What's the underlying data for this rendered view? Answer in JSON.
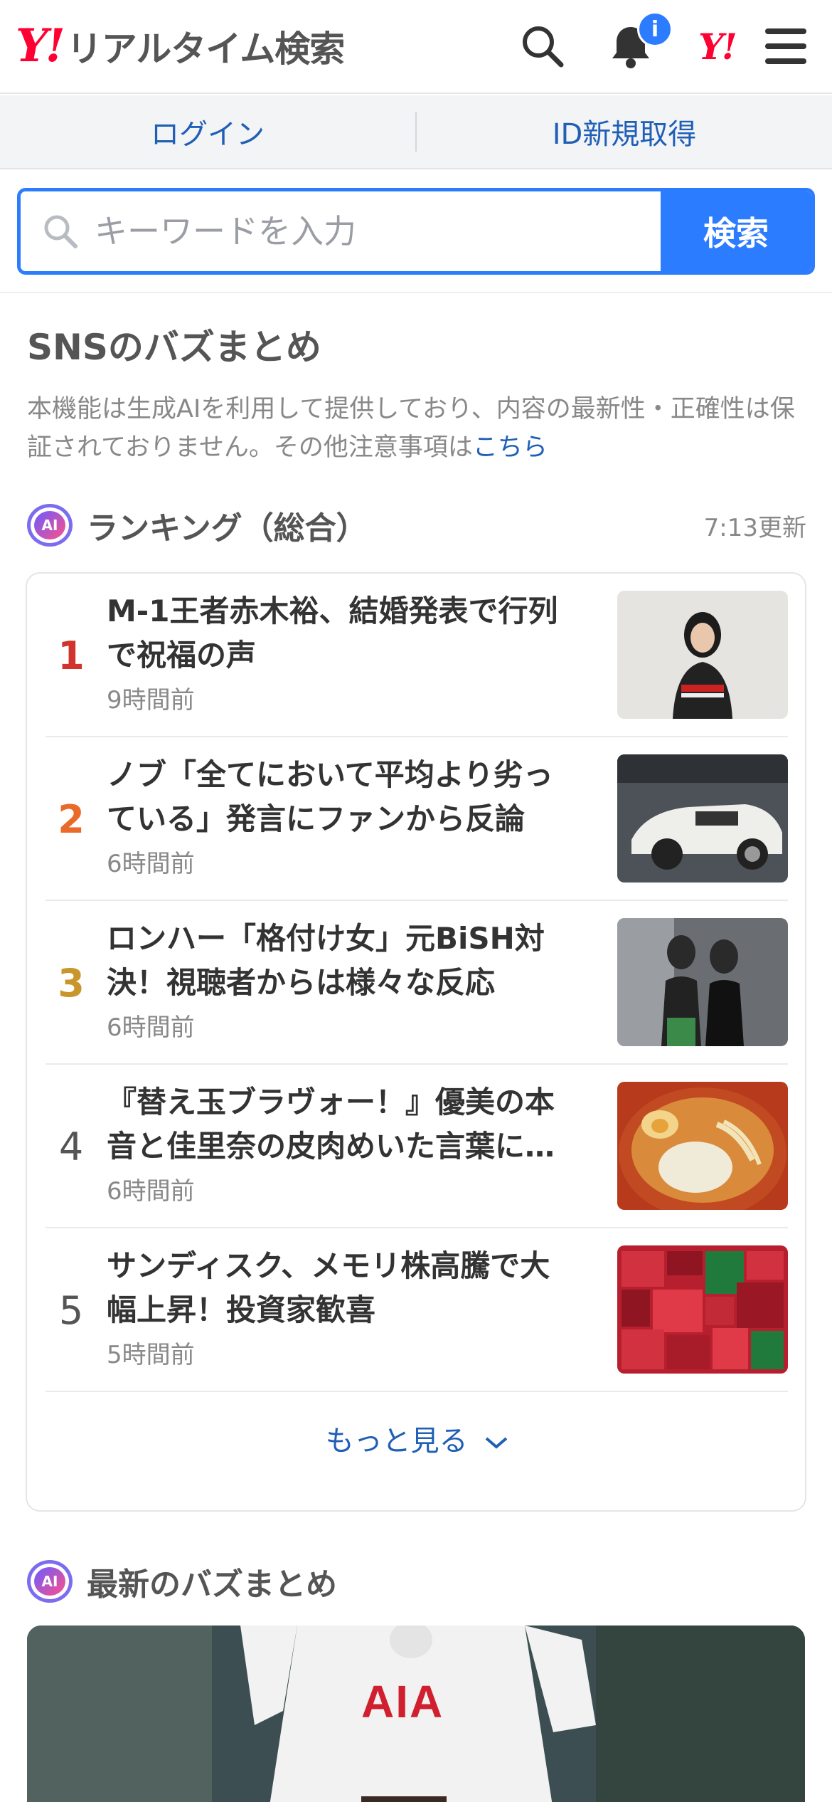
{
  "header": {
    "logo_mark": "Y!",
    "logo_text": "リアルタイム検索",
    "notification_badge": "i",
    "yj_mark": "Y!"
  },
  "loginbar": {
    "login": "ログイン",
    "signup": "ID新規取得"
  },
  "search": {
    "placeholder": "キーワードを入力",
    "button": "検索"
  },
  "section": {
    "title": "SNSのバズまとめ",
    "disclaimer": "本機能は生成AIを利用して提供しており、内容の最新性・正確性は保証されておりません。その他注意事項は",
    "disclaimer_link": "こちら"
  },
  "ranking": {
    "ai_label": "AI",
    "title": "ランキング（総合）",
    "updated": "7:13更新",
    "items": [
      {
        "rank": "1",
        "title": "M-1王者赤木裕、結婚発表で行列で祝福の声",
        "time": "9時間前",
        "rank_color": "#d0342c"
      },
      {
        "rank": "2",
        "title": "ノブ「全てにおいて平均より劣っている」発言にファンから反論",
        "time": "6時間前",
        "rank_color": "#ea6a2a"
      },
      {
        "rank": "3",
        "title": "ロンハー「格付け女」元BiSH対決！視聴者からは様々な反応",
        "time": "6時間前",
        "rank_color": "#c8962a"
      },
      {
        "rank": "4",
        "title": "『替え玉ブラヴォー！』優美の本音と佳里奈の皮肉めいた言葉に…",
        "time": "6時間前",
        "rank_color": "#555555"
      },
      {
        "rank": "5",
        "title": "サンディスク、メモリ株高騰で大幅上昇！投資家歓喜",
        "time": "5時間前",
        "rank_color": "#555555"
      }
    ],
    "more": "もっと見る"
  },
  "latest": {
    "ai_label": "AI",
    "title": "最新のバズまとめ",
    "hero_text": "AIA"
  }
}
